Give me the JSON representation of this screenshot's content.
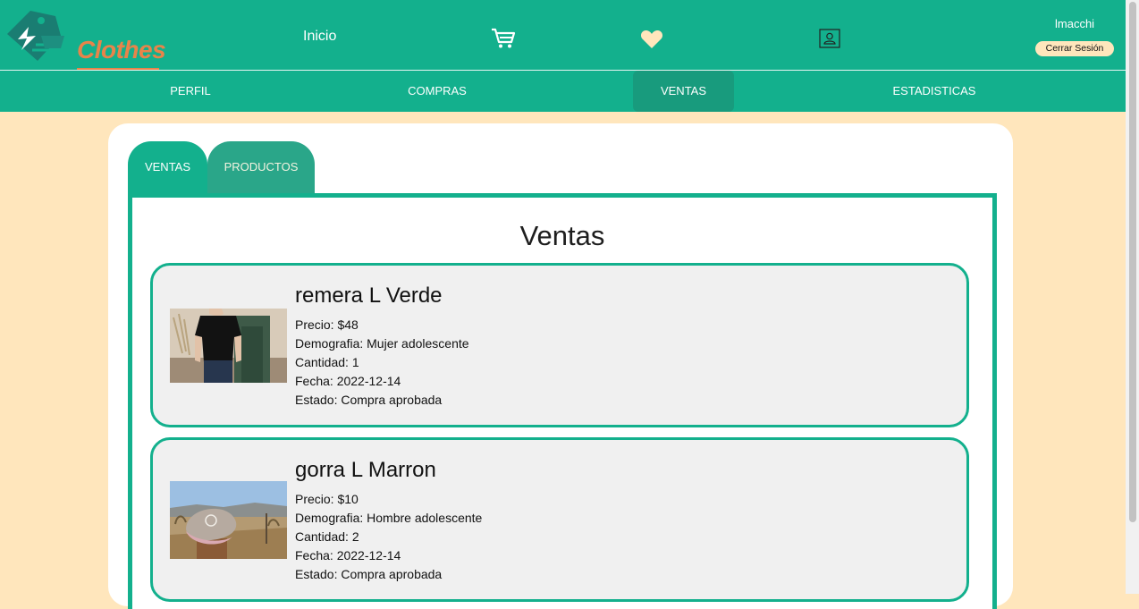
{
  "app": {
    "logo_text": "Clothes"
  },
  "header": {
    "nav_home": "Inicio",
    "icons": [
      "cart-icon",
      "heart-icon",
      "profile-icon"
    ],
    "username": "lmacchi",
    "logout_label": "Cerrar Sesión"
  },
  "subnav": {
    "items": [
      {
        "label": "PERFIL"
      },
      {
        "label": "COMPRAS"
      },
      {
        "label": "VENTAS"
      },
      {
        "label": "ESTADISTICAS"
      }
    ],
    "active": "VENTAS"
  },
  "tabs": [
    {
      "label": "VENTAS"
    },
    {
      "label": "PRODUCTOS"
    }
  ],
  "page": {
    "title": "Ventas"
  },
  "sales": [
    {
      "name": "remera L Verde",
      "price": "Precio: $48",
      "demographic": "Demografia: Mujer adolescente",
      "quantity": "Cantidad: 1",
      "date": "Fecha: 2022-12-14",
      "status": "Estado: Compra aprobada"
    },
    {
      "name": "gorra L Marron",
      "price": "Precio: $10",
      "demographic": "Demografia: Hombre adolescente",
      "quantity": "Cantidad: 2",
      "date": "Fecha: 2022-12-14",
      "status": "Estado: Compra aprobada"
    }
  ],
  "colors": {
    "primary": "#13b08d",
    "background": "#ffe6bc",
    "accent_logo": "#e8844a"
  }
}
